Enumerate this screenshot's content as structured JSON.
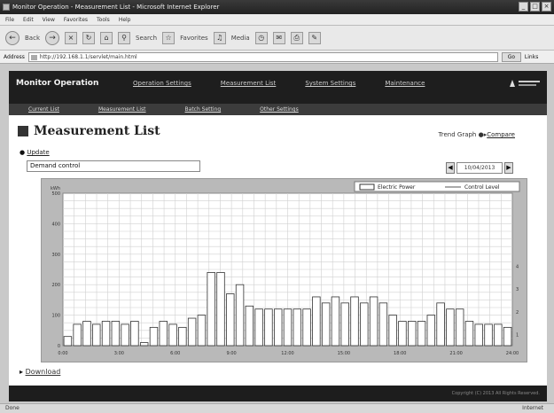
{
  "window": {
    "title": "Monitor Operation - Measurement List - Microsoft Internet Explorer"
  },
  "menubar": [
    "File",
    "Edit",
    "View",
    "Favorites",
    "Tools",
    "Help"
  ],
  "toolbar": {
    "back_label": "Back",
    "search_label": "Search",
    "favorites_label": "Favorites",
    "media_label": "Media"
  },
  "address": {
    "label": "Address",
    "value": "http://192.168.1.1/servlet/main.html",
    "go_label": "Go",
    "links_label": "Links"
  },
  "header": {
    "brand": "Monitor Operation",
    "nav": [
      "Operation Settings",
      "Measurement List",
      "System Settings",
      "Maintenance"
    ]
  },
  "subnav": [
    "Current List",
    "Measurement List",
    "Batch Setting",
    "Other Settings"
  ],
  "page": {
    "title": "Measurement List",
    "trend_label": "Trend Graph",
    "trend_link": "Compare",
    "update_link": "Update",
    "item_select_value": "Demand control",
    "date_value": "10/04/2013",
    "download_link": "Download"
  },
  "chart_data": {
    "type": "bar",
    "legend": [
      {
        "name": "Electric Power",
        "style": "bar"
      },
      {
        "name": "Control Level",
        "style": "line"
      }
    ],
    "legend_position": "top-right",
    "y_label": "kWh",
    "ylim": [
      0,
      500
    ],
    "y_ticks": [
      "500",
      "400",
      "300",
      "200",
      "100",
      "0"
    ],
    "y2_ticks": [
      "4",
      "3",
      "2",
      "1"
    ],
    "x_ticks": [
      "0:00",
      "3:00",
      "6:00",
      "9:00",
      "12:00",
      "15:00",
      "18:00",
      "21:00",
      "24:00"
    ],
    "grid": true,
    "series": [
      {
        "name": "Electric Power",
        "values": [
          30,
          70,
          80,
          70,
          80,
          80,
          70,
          80,
          10,
          60,
          80,
          70,
          60,
          90,
          100,
          240,
          240,
          170,
          200,
          130,
          120,
          120,
          120,
          120,
          120,
          120,
          160,
          140,
          160,
          140,
          160,
          140,
          160,
          140,
          100,
          80,
          80,
          80,
          100,
          140,
          120,
          120,
          80,
          70,
          70,
          70,
          60
        ]
      }
    ]
  },
  "footer": {
    "copyright": "Copyright (C) 2013 All Rights Reserved."
  },
  "status": {
    "text": "Done",
    "zone": "Internet"
  },
  "colors": {
    "header_bg": "#1e1e1e",
    "plot_bg": "#ffffff",
    "bar_fill": "#ffffff",
    "bar_stroke": "#333333"
  }
}
